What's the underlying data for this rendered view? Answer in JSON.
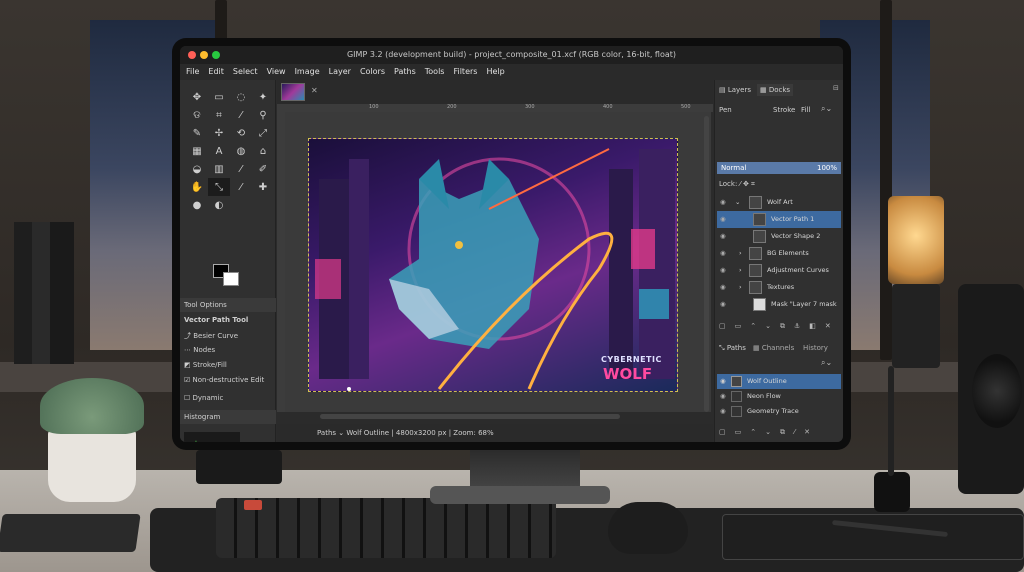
{
  "window": {
    "title": "GIMP 3.2 (development build) - project_composite_01.xcf (RGB color, 16-bit, float)"
  },
  "menu": [
    "File",
    "Edit",
    "Select",
    "View",
    "Image",
    "Layer",
    "Colors",
    "Paths",
    "Tools",
    "Filters",
    "Help"
  ],
  "toolbox": {
    "tool_options_label": "Tool Options",
    "tool_name": "Vector Path Tool",
    "options": [
      "Besier Curve",
      "Nodes",
      "Stroke/Fill",
      "Non-destructive Edit",
      "Dynamic"
    ],
    "histogram_label": "Histogram"
  },
  "canvas": {
    "ruler_marks": [
      "100",
      "200",
      "300",
      "400",
      "500"
    ],
    "art_text_line1": "CYBERNETIC",
    "art_text_line2": "WOLF"
  },
  "status": {
    "mode": "Paths",
    "text": "Wolf Outline | 4800x3200 px | Zoom: 68%"
  },
  "docks": {
    "tabs": [
      "Layers",
      "Docks"
    ],
    "pen_label": "Pen",
    "stroke_label": "Stroke",
    "fill_label": "Fill",
    "blend_mode": "Normal",
    "opacity": "100%",
    "lock_label": "Lock:",
    "layers": [
      {
        "name": "Wolf Art"
      },
      {
        "name": "Vector Path 1"
      },
      {
        "name": "Vector Shape 2"
      },
      {
        "name": "BG Elements"
      },
      {
        "name": "Adjustment Curves"
      },
      {
        "name": "Textures"
      },
      {
        "name": "Mask \"Layer 7 mask"
      }
    ],
    "lower_tabs": [
      "Paths",
      "Channels",
      "History"
    ],
    "paths": [
      {
        "name": "Wolf Outline"
      },
      {
        "name": "Neon Flow"
      },
      {
        "name": "Geometry Trace"
      }
    ]
  },
  "colors": {
    "accent": "#3d6aa0",
    "mode_bar": "#5a7aa8",
    "selection_border": "#d0c050"
  }
}
